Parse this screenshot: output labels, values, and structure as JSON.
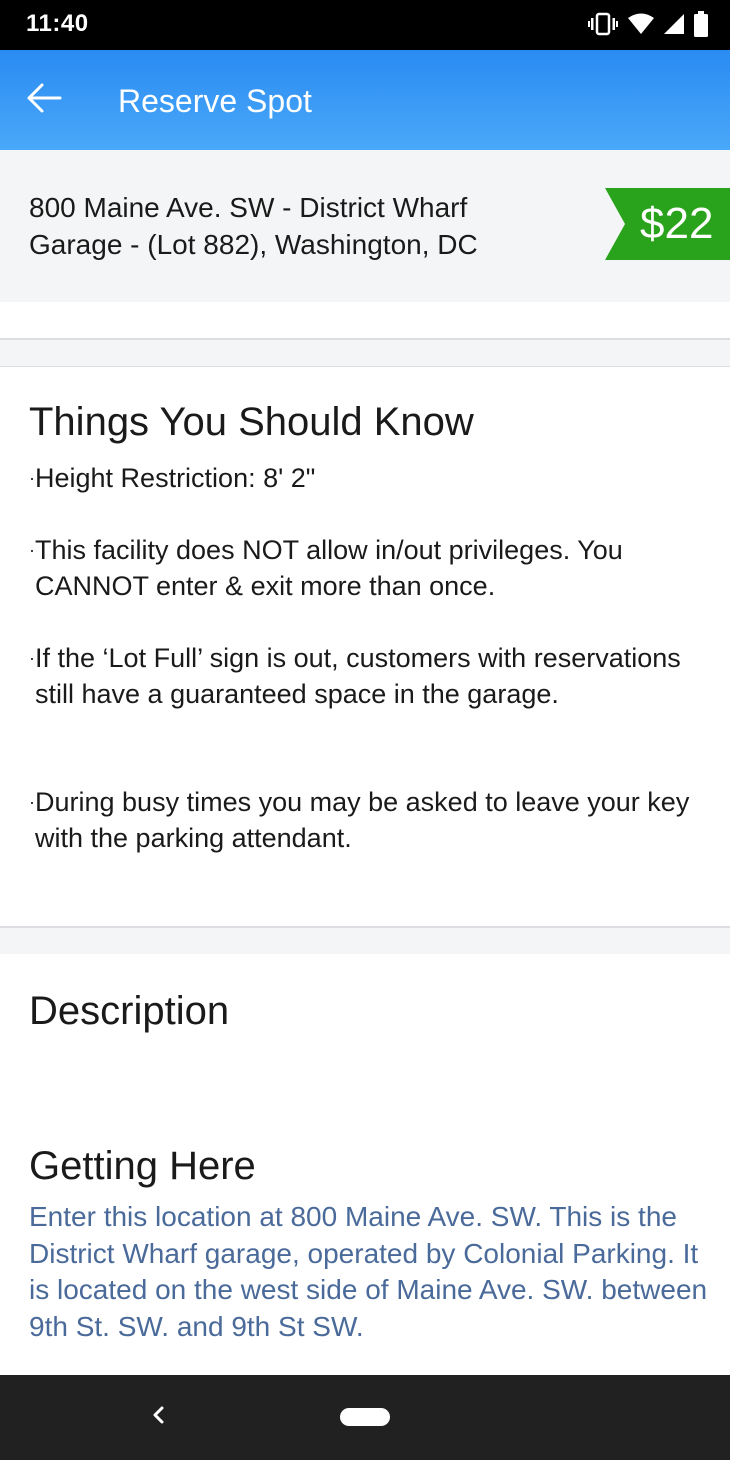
{
  "status_bar": {
    "time": "11:40",
    "icons": [
      "vibrate-icon",
      "wifi-icon",
      "signal-icon",
      "battery-icon"
    ]
  },
  "app_bar": {
    "title": "Reserve Spot",
    "back_icon": "arrow-left-icon",
    "background_color": "#2a8bf2"
  },
  "location": {
    "address_line1": "800 Maine Ave. SW - District Wharf",
    "address_line2": "Garage - (Lot 882), Washington, DC",
    "price": "$22",
    "price_color": "#2aa31c"
  },
  "things_to_know": {
    "heading": "Things You Should Know",
    "bullet_char": "·",
    "items": [
      "Height Restriction: 8' 2\"",
      "This facility does NOT allow in/out privileges. You CANNOT enter & exit more than once.",
      "If the ‘Lot Full’ sign is out, customers with reservations still have a guaranteed space in the garage.",
      "During busy times you may be asked to leave your key with the parking attendant."
    ]
  },
  "description": {
    "heading": "Description"
  },
  "getting_here": {
    "heading": "Getting Here",
    "text": "Enter this location at 800 Maine Ave. SW. This is the District Wharf garage, operated by Colonial Parking. It is located on the west side of Maine Ave. SW. between 9th St. SW. and 9th St SW.",
    "text_color": "#4a6a9a"
  },
  "nav_bar": {
    "back_icon": "nav-back-icon",
    "home_icon": "home-pill-icon"
  }
}
